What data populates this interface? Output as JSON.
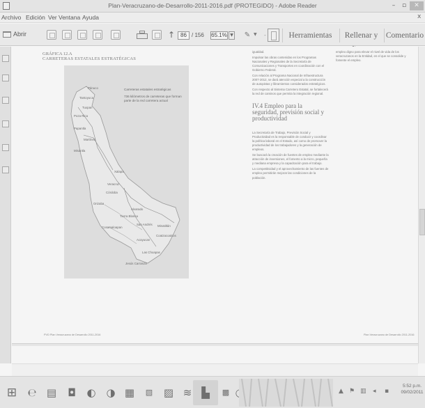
{
  "window": {
    "title": "Plan-Veracruzano-de-Desarrollo-2011-2016.pdf (PROTEGIDO) - Adobe Reader"
  },
  "menu": {
    "items": [
      "Archivo",
      "Edición",
      "Ver",
      "Ventana",
      "Ayuda"
    ],
    "close": "x"
  },
  "toolbar": {
    "open_label": "Abrir",
    "page_current": "86",
    "page_total": "/ 156",
    "zoom": "65.1%",
    "pane_buttons": [
      "Herramientas",
      "Rellenar y firmar",
      "Comentario"
    ]
  },
  "document": {
    "section_label": "GRÁFICA 12.A",
    "section_title": "CARRETERAS ESTATALES ESTRATÉGICAS",
    "map": {
      "legend_line1": "Carreteras estatales estratégicas",
      "legend_line2": "736 kilómetros de carreteras que forman parte de la red carretera actual",
      "cities": [
        "Pánuco",
        "Tantoyuca",
        "Tuxpan",
        "Poza Rica",
        "Papantla",
        "Martínez",
        "Misantla",
        "Xalapa",
        "Veracruz",
        "Córdoba",
        "Orizaba",
        "Tierra Blanca",
        "Alvarado",
        "Cosamaloapan",
        "San Andrés",
        "Acayucan",
        "Minatitlán",
        "Coatzacoalcos",
        "Las Choapas",
        "Jesús Carranza"
      ]
    },
    "column1_top": "igualdad.",
    "column1_paragraphs": [
      "Impulsar las obras contenidas en los Programas Nacionales y Regionales de la Secretaría de Comunicaciones y Transportes en coordinación con el Gobierno Federal.",
      "Con relación al Programa Nacional de Infraestructura 2007-2012, se dará atención especial a la construcción de autopistas y libramientos considerados estratégicos.",
      "Con respecto al Sistema Carretero Estatal, se fortalecerá la red de caminos que permita la integración regional."
    ],
    "heading": "IV.4 Empleo para la seguridad, previsión social y productividad",
    "column1_paragraphs_2": [
      "La Secretaría de Trabajo, Previsión Social y Productividad es la responsable de conducir y coordinar la política laboral en el Estado, así como de promover la productividad de los trabajadores y la generación de empleos.",
      "Se buscará la creación de fuentes de empleo mediante la atracción de inversiones, el fomento a la micro, pequeña y mediana empresa y la capacitación para el trabajo.",
      "La competitividad y el aprovechamiento de las fuentes de empleo permitirán mejorar las condiciones de la población."
    ],
    "column2_paragraphs": [
      "empleo digno para elevar el nivel de vida de los veracruzanos en la Entidad, en el que se consolide y fomente el empleo."
    ],
    "footer_left": "PVD Plan Veracruzano de Desarrollo 2011-2016",
    "footer_right": "Plan Veracruzano de Desarrollo 2011-2016"
  },
  "taskbar": {
    "clock_time": "5:52 p.m.",
    "clock_date": "09/02/2011"
  }
}
